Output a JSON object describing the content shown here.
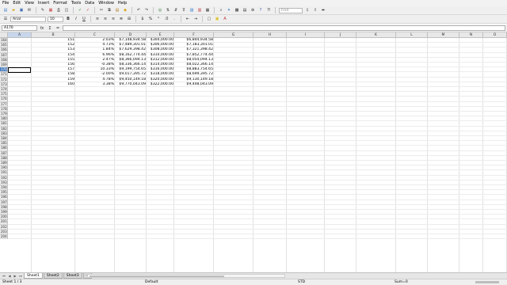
{
  "menu": [
    "File",
    "Edit",
    "View",
    "Insert",
    "Format",
    "Tools",
    "Data",
    "Window",
    "Help"
  ],
  "toolbar": {
    "find_placeholder": "Find",
    "font_name": "Arial",
    "font_size": "10",
    "bold": "B",
    "italic": "I",
    "underline": "U"
  },
  "formula_bar": {
    "name_box": "A170",
    "fx_label": "fx",
    "sum_label": "Σ",
    "equals_label": "="
  },
  "columns": [
    "A",
    "B",
    "C",
    "D",
    "E",
    "F",
    "G",
    "H",
    "I",
    "J",
    "K",
    "L",
    "M",
    "N",
    "O",
    "P"
  ],
  "selected_row": "170",
  "row_numbers": [
    "164",
    "165",
    "166",
    "167",
    "168",
    "169",
    "170",
    "171",
    "172",
    "173",
    "174",
    "175",
    "176",
    "177",
    "178",
    "179",
    "180",
    "181",
    "182",
    "183",
    "184",
    "185",
    "186",
    "187",
    "188",
    "189",
    "190",
    "191",
    "192",
    "193",
    "194",
    "195",
    "196",
    "197",
    "198",
    "199",
    "200",
    "201",
    "202",
    "203",
    "204"
  ],
  "rows": [
    {
      "b": "151",
      "c": "2.03%",
      "d": "$7,148,934.58",
      "e": "$304,000.00",
      "f": "$6,844,934.58"
    },
    {
      "b": "152",
      "c": "4.73%",
      "d": "$7,489,301.01",
      "e": "$306,000.00",
      "f": "$7,183,301.01"
    },
    {
      "b": "153",
      "c": "1.84%",
      "d": "$7,629,398.42",
      "e": "$308,000.00",
      "f": "$7,321,398.42"
    },
    {
      "b": "154",
      "c": "6.96%",
      "d": "$8,162,774.44",
      "e": "$310,000.00",
      "f": "$7,852,774.44"
    },
    {
      "b": "155",
      "c": "2.47%",
      "d": "$8,366,094.13",
      "e": "$312,000.00",
      "f": "$8,054,094.13"
    },
    {
      "b": "156",
      "c": "-0.38%",
      "d": "$8,336,366.14",
      "e": "$314,000.00",
      "f": "$8,022,366.14"
    },
    {
      "b": "157",
      "c": "10.33%",
      "d": "$9,199,754.65",
      "e": "$316,000.00",
      "f": "$8,883,754.65"
    },
    {
      "b": "158",
      "c": "-2.00%",
      "d": "$9,017,395.72",
      "e": "$318,000.00",
      "f": "$8,699,395.72"
    },
    {
      "b": "159",
      "c": "4.78%",
      "d": "$9,450,149.18",
      "e": "$320,000.00",
      "f": "$9,130,149.18"
    },
    {
      "b": "160",
      "c": "3.38%",
      "d": "$9,770,043.09",
      "e": "$322,000.00",
      "f": "$9,448,043.09"
    }
  ],
  "tabs": {
    "sheet1": "Sheet1",
    "sheet2": "Sheet2",
    "sheet3": "Sheet3",
    "add": "+"
  },
  "status": {
    "sheet": "Sheet 1 / 3",
    "style": "Default",
    "mode": "STD",
    "sum": "Sum=0"
  }
}
